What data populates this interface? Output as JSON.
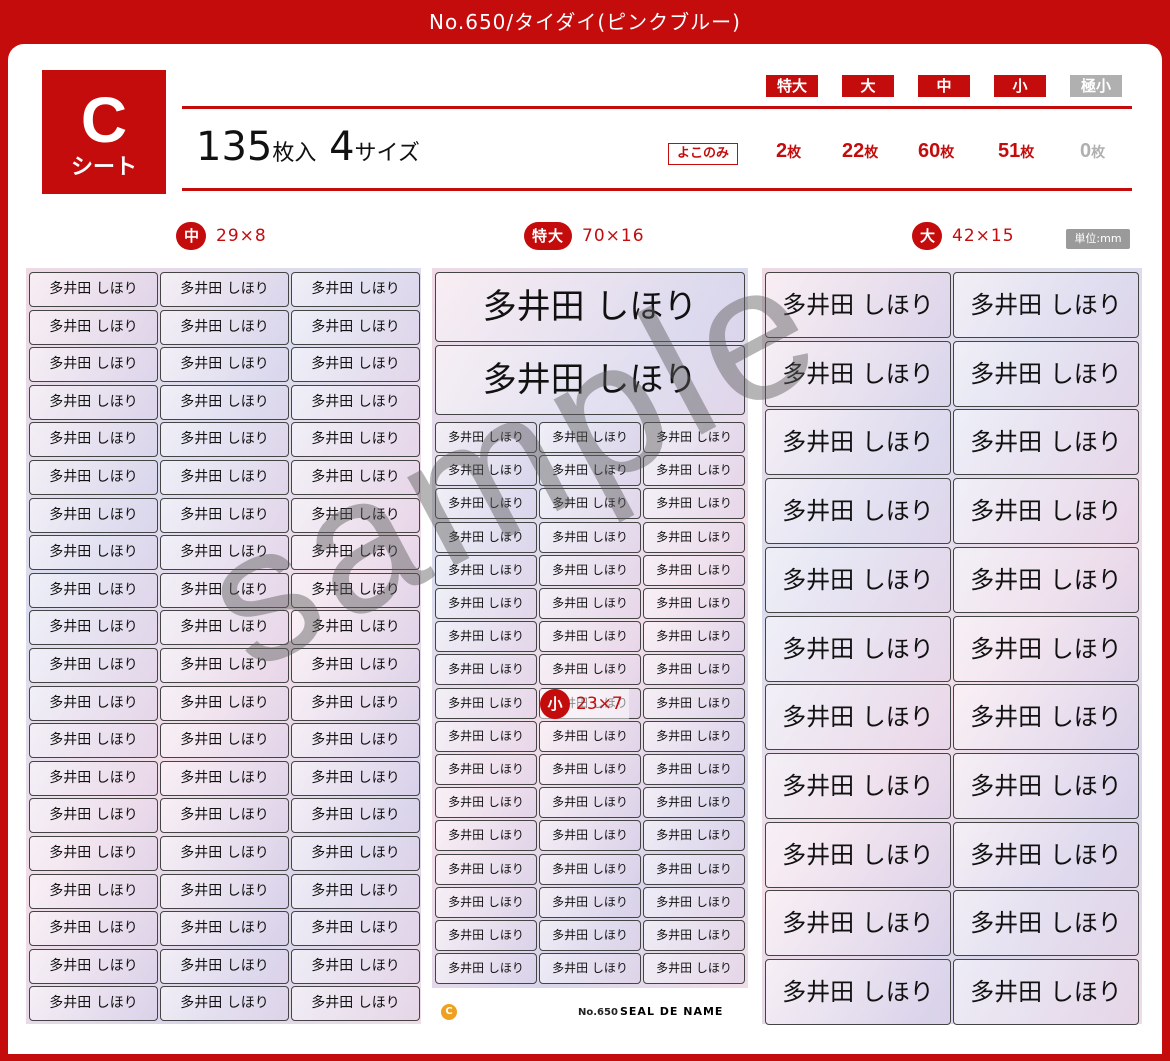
{
  "header": {
    "title": "No.650/タイダイ(ピンクブルー)"
  },
  "badge": {
    "letter": "C",
    "sub": "シート"
  },
  "sizes": [
    {
      "label": "特大",
      "color": "#c40c0c"
    },
    {
      "label": "大",
      "color": "#c40c0c"
    },
    {
      "label": "中",
      "color": "#c40c0c"
    },
    {
      "label": "小",
      "color": "#c40c0c"
    },
    {
      "label": "極小",
      "color": "#b0b0b0"
    }
  ],
  "summary": {
    "count": "135",
    "count_unit": "枚入",
    "sizes_num": "4",
    "sizes_unit": "サイズ"
  },
  "yoko": "よこのみ",
  "quantities": [
    {
      "num": "2",
      "unit": "枚",
      "color": "#c40c0c"
    },
    {
      "num": "22",
      "unit": "枚",
      "color": "#c40c0c"
    },
    {
      "num": "60",
      "unit": "枚",
      "color": "#c40c0c"
    },
    {
      "num": "51",
      "unit": "枚",
      "color": "#c40c0c"
    },
    {
      "num": "0",
      "unit": "枚",
      "color": "#b0b0b0"
    }
  ],
  "sections": {
    "medium": {
      "tag": "中",
      "dims": "29×8"
    },
    "xlarge": {
      "tag": "特大",
      "dims": "70×16"
    },
    "large": {
      "tag": "大",
      "dims": "42×15"
    },
    "small": {
      "tag": "小",
      "dims": "23×7"
    }
  },
  "unit": "単位:mm",
  "label_text": "多井田 しほり",
  "watermark": "sample",
  "footer": {
    "c": "C",
    "no": "No.650",
    "logo": "SEAL DE NAME"
  },
  "colors": {
    "accent": "#c40c0c",
    "inactive": "#b0b0b0"
  }
}
